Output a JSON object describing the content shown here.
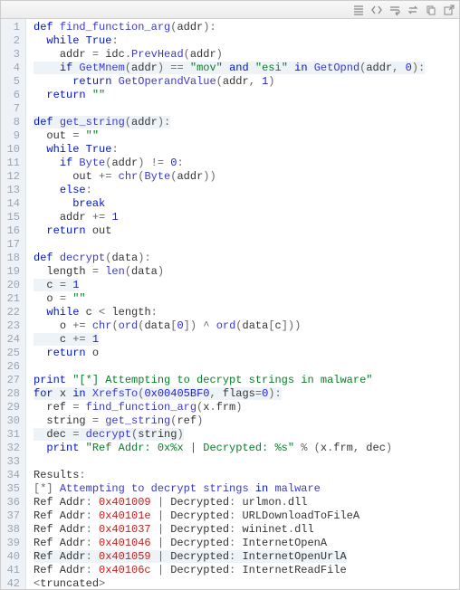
{
  "toolbar": {
    "icons": [
      "justify-icon",
      "code-icon",
      "wrap-icon",
      "swap-icon",
      "copy-icon",
      "popout-icon"
    ]
  },
  "highlights": [
    4,
    8,
    20,
    24,
    28,
    31,
    40
  ],
  "lines": [
    {
      "n": 1,
      "seg": [
        [
          "kw",
          "def "
        ],
        [
          "fn",
          "find_function_arg"
        ],
        [
          "op",
          "("
        ],
        [
          "ident",
          "addr"
        ],
        [
          "op",
          ")"
        ],
        [
          "op",
          ":"
        ]
      ]
    },
    {
      "n": 2,
      "seg": [
        [
          "",
          "  "
        ],
        [
          "kw",
          "while "
        ],
        [
          "kw",
          "True"
        ],
        [
          "op",
          ":"
        ]
      ]
    },
    {
      "n": 3,
      "seg": [
        [
          "",
          "    "
        ],
        [
          "ident",
          "addr "
        ],
        [
          "op",
          "= "
        ],
        [
          "ident",
          "idc"
        ],
        [
          "op",
          "."
        ],
        [
          "fn",
          "PrevHead"
        ],
        [
          "op",
          "("
        ],
        [
          "ident",
          "addr"
        ],
        [
          "op",
          ")"
        ]
      ]
    },
    {
      "n": 4,
      "seg": [
        [
          "",
          "    "
        ],
        [
          "kw",
          "if "
        ],
        [
          "fn",
          "GetMnem"
        ],
        [
          "op",
          "("
        ],
        [
          "ident",
          "addr"
        ],
        [
          "op",
          ") "
        ],
        [
          "op",
          "== "
        ],
        [
          "str",
          "\"mov\" "
        ],
        [
          "kw",
          "and "
        ],
        [
          "str",
          "\"esi\" "
        ],
        [
          "kw",
          "in "
        ],
        [
          "fn",
          "GetOpnd"
        ],
        [
          "op",
          "("
        ],
        [
          "ident",
          "addr"
        ],
        [
          "op",
          ", "
        ],
        [
          "num",
          "0"
        ],
        [
          "op",
          "):"
        ]
      ]
    },
    {
      "n": 5,
      "seg": [
        [
          "",
          "      "
        ],
        [
          "kw",
          "return "
        ],
        [
          "fn",
          "GetOperandValue"
        ],
        [
          "op",
          "("
        ],
        [
          "ident",
          "addr"
        ],
        [
          "op",
          ", "
        ],
        [
          "num",
          "1"
        ],
        [
          "op",
          ")"
        ]
      ]
    },
    {
      "n": 6,
      "seg": [
        [
          "",
          "  "
        ],
        [
          "kw",
          "return "
        ],
        [
          "str",
          "\"\""
        ]
      ]
    },
    {
      "n": 7,
      "seg": [
        [
          "",
          ""
        ]
      ]
    },
    {
      "n": 8,
      "seg": [
        [
          "kw",
          "def "
        ],
        [
          "fn",
          "get_string"
        ],
        [
          "op",
          "("
        ],
        [
          "ident",
          "addr"
        ],
        [
          "op",
          "):"
        ]
      ]
    },
    {
      "n": 9,
      "seg": [
        [
          "",
          "  "
        ],
        [
          "ident",
          "out "
        ],
        [
          "op",
          "= "
        ],
        [
          "str",
          "\"\""
        ]
      ]
    },
    {
      "n": 10,
      "seg": [
        [
          "",
          "  "
        ],
        [
          "kw",
          "while "
        ],
        [
          "kw",
          "True"
        ],
        [
          "op",
          ":"
        ]
      ]
    },
    {
      "n": 11,
      "seg": [
        [
          "",
          "    "
        ],
        [
          "kw",
          "if "
        ],
        [
          "fn",
          "Byte"
        ],
        [
          "op",
          "("
        ],
        [
          "ident",
          "addr"
        ],
        [
          "op",
          ") "
        ],
        [
          "op",
          "!= "
        ],
        [
          "num",
          "0"
        ],
        [
          "op",
          ":"
        ]
      ]
    },
    {
      "n": 12,
      "seg": [
        [
          "",
          "      "
        ],
        [
          "ident",
          "out "
        ],
        [
          "op",
          "+= "
        ],
        [
          "fn",
          "chr"
        ],
        [
          "op",
          "("
        ],
        [
          "fn",
          "Byte"
        ],
        [
          "op",
          "("
        ],
        [
          "ident",
          "addr"
        ],
        [
          "op",
          "))"
        ]
      ]
    },
    {
      "n": 13,
      "seg": [
        [
          "",
          "    "
        ],
        [
          "kw",
          "else"
        ],
        [
          "op",
          ":"
        ]
      ]
    },
    {
      "n": 14,
      "seg": [
        [
          "",
          "      "
        ],
        [
          "kw",
          "break"
        ]
      ]
    },
    {
      "n": 15,
      "seg": [
        [
          "",
          "    "
        ],
        [
          "ident",
          "addr "
        ],
        [
          "op",
          "+= "
        ],
        [
          "num",
          "1"
        ]
      ]
    },
    {
      "n": 16,
      "seg": [
        [
          "",
          "  "
        ],
        [
          "kw",
          "return "
        ],
        [
          "ident",
          "out"
        ]
      ]
    },
    {
      "n": 17,
      "seg": [
        [
          "",
          ""
        ]
      ]
    },
    {
      "n": 18,
      "seg": [
        [
          "kw",
          "def "
        ],
        [
          "fn",
          "decrypt"
        ],
        [
          "op",
          "("
        ],
        [
          "ident",
          "data"
        ],
        [
          "op",
          "):"
        ]
      ]
    },
    {
      "n": 19,
      "seg": [
        [
          "",
          "  "
        ],
        [
          "ident",
          "length "
        ],
        [
          "op",
          "= "
        ],
        [
          "fn",
          "len"
        ],
        [
          "op",
          "("
        ],
        [
          "ident",
          "data"
        ],
        [
          "op",
          ")"
        ]
      ]
    },
    {
      "n": 20,
      "seg": [
        [
          "",
          "  "
        ],
        [
          "ident",
          "c "
        ],
        [
          "op",
          "= "
        ],
        [
          "num",
          "1"
        ]
      ]
    },
    {
      "n": 21,
      "seg": [
        [
          "",
          "  "
        ],
        [
          "ident",
          "o "
        ],
        [
          "op",
          "= "
        ],
        [
          "str",
          "\"\""
        ]
      ]
    },
    {
      "n": 22,
      "seg": [
        [
          "",
          "  "
        ],
        [
          "kw",
          "while "
        ],
        [
          "ident",
          "c "
        ],
        [
          "op",
          "< "
        ],
        [
          "ident",
          "length"
        ],
        [
          "op",
          ":"
        ]
      ]
    },
    {
      "n": 23,
      "seg": [
        [
          "",
          "    "
        ],
        [
          "ident",
          "o "
        ],
        [
          "op",
          "+= "
        ],
        [
          "fn",
          "chr"
        ],
        [
          "op",
          "("
        ],
        [
          "fn",
          "ord"
        ],
        [
          "op",
          "("
        ],
        [
          "ident",
          "data"
        ],
        [
          "op",
          "["
        ],
        [
          "num",
          "0"
        ],
        [
          "op",
          "]) "
        ],
        [
          "op",
          "^ "
        ],
        [
          "fn",
          "ord"
        ],
        [
          "op",
          "("
        ],
        [
          "ident",
          "data"
        ],
        [
          "op",
          "["
        ],
        [
          "ident",
          "c"
        ],
        [
          "op",
          "]))"
        ]
      ]
    },
    {
      "n": 24,
      "seg": [
        [
          "",
          "    "
        ],
        [
          "ident",
          "c "
        ],
        [
          "op",
          "+= "
        ],
        [
          "num",
          "1"
        ]
      ]
    },
    {
      "n": 25,
      "seg": [
        [
          "",
          "  "
        ],
        [
          "kw",
          "return "
        ],
        [
          "ident",
          "o"
        ]
      ]
    },
    {
      "n": 26,
      "seg": [
        [
          "",
          ""
        ]
      ]
    },
    {
      "n": 27,
      "seg": [
        [
          "kw",
          "print "
        ],
        [
          "str",
          "\"[*] Attempting to decrypt strings in malware\""
        ]
      ]
    },
    {
      "n": 28,
      "seg": [
        [
          "kw",
          "for "
        ],
        [
          "ident",
          "x "
        ],
        [
          "kw",
          "in "
        ],
        [
          "fn",
          "XrefsTo"
        ],
        [
          "op",
          "("
        ],
        [
          "num",
          "0x00405BF0"
        ],
        [
          "op",
          ", "
        ],
        [
          "ident",
          "flags"
        ],
        [
          "op",
          "="
        ],
        [
          "num",
          "0"
        ],
        [
          "op",
          "):"
        ]
      ]
    },
    {
      "n": 29,
      "seg": [
        [
          "",
          "  "
        ],
        [
          "ident",
          "ref "
        ],
        [
          "op",
          "= "
        ],
        [
          "fn",
          "find_function_arg"
        ],
        [
          "op",
          "("
        ],
        [
          "ident",
          "x"
        ],
        [
          "op",
          "."
        ],
        [
          "ident",
          "frm"
        ],
        [
          "op",
          ")"
        ]
      ]
    },
    {
      "n": 30,
      "seg": [
        [
          "",
          "  "
        ],
        [
          "ident",
          "string "
        ],
        [
          "op",
          "= "
        ],
        [
          "fn",
          "get_string"
        ],
        [
          "op",
          "("
        ],
        [
          "ident",
          "ref"
        ],
        [
          "op",
          ")"
        ]
      ]
    },
    {
      "n": 31,
      "seg": [
        [
          "",
          "  "
        ],
        [
          "ident",
          "dec "
        ],
        [
          "op",
          "= "
        ],
        [
          "fn",
          "decrypt"
        ],
        [
          "op",
          "("
        ],
        [
          "ident",
          "string"
        ],
        [
          "op",
          ")"
        ]
      ]
    },
    {
      "n": 32,
      "seg": [
        [
          "",
          "  "
        ],
        [
          "kw",
          "print "
        ],
        [
          "str",
          "\"Ref Addr: 0x%x | Decrypted: %s\" "
        ],
        [
          "op",
          "% "
        ],
        [
          "op",
          "("
        ],
        [
          "ident",
          "x"
        ],
        [
          "op",
          "."
        ],
        [
          "ident",
          "frm"
        ],
        [
          "op",
          ", "
        ],
        [
          "ident",
          "dec"
        ],
        [
          "op",
          ")"
        ]
      ]
    },
    {
      "n": 33,
      "seg": [
        [
          "",
          ""
        ]
      ]
    },
    {
      "n": 34,
      "seg": [
        [
          "ident",
          "Results"
        ],
        [
          "op",
          ":"
        ]
      ]
    },
    {
      "n": 35,
      "seg": [
        [
          "op",
          "["
        ],
        [
          "op",
          "*"
        ],
        [
          "op",
          "] "
        ],
        [
          "fn",
          "Attempting to decrypt strings "
        ],
        [
          "kw",
          "in "
        ],
        [
          "fn",
          "malware"
        ]
      ]
    },
    {
      "n": 36,
      "seg": [
        [
          "ident",
          "Ref Addr"
        ],
        [
          "op",
          ": "
        ],
        [
          "hexaddr",
          "0x401009"
        ],
        [
          "op",
          " | "
        ],
        [
          "ident",
          "Decrypted"
        ],
        [
          "op",
          ": "
        ],
        [
          "ident",
          "urlmon"
        ],
        [
          "op",
          "."
        ],
        [
          "ident",
          "dll"
        ]
      ]
    },
    {
      "n": 37,
      "seg": [
        [
          "ident",
          "Ref Addr"
        ],
        [
          "op",
          ": "
        ],
        [
          "hexaddr",
          "0x40101e"
        ],
        [
          "op",
          " | "
        ],
        [
          "ident",
          "Decrypted"
        ],
        [
          "op",
          ": "
        ],
        [
          "ident",
          "URLDownloadToFileA"
        ]
      ]
    },
    {
      "n": 38,
      "seg": [
        [
          "ident",
          "Ref Addr"
        ],
        [
          "op",
          ": "
        ],
        [
          "hexaddr",
          "0x401037"
        ],
        [
          "op",
          " | "
        ],
        [
          "ident",
          "Decrypted"
        ],
        [
          "op",
          ": "
        ],
        [
          "ident",
          "wininet"
        ],
        [
          "op",
          "."
        ],
        [
          "ident",
          "dll"
        ]
      ]
    },
    {
      "n": 39,
      "seg": [
        [
          "ident",
          "Ref Addr"
        ],
        [
          "op",
          ": "
        ],
        [
          "hexaddr",
          "0x401046"
        ],
        [
          "op",
          " | "
        ],
        [
          "ident",
          "Decrypted"
        ],
        [
          "op",
          ": "
        ],
        [
          "ident",
          "InternetOpenA"
        ]
      ]
    },
    {
      "n": 40,
      "seg": [
        [
          "ident",
          "Ref Addr"
        ],
        [
          "op",
          ": "
        ],
        [
          "hexaddr",
          "0x401059"
        ],
        [
          "op",
          " | "
        ],
        [
          "ident",
          "Decrypted"
        ],
        [
          "op",
          ": "
        ],
        [
          "ident",
          "InternetOpenUrlA"
        ]
      ]
    },
    {
      "n": 41,
      "seg": [
        [
          "ident",
          "Ref Addr"
        ],
        [
          "op",
          ": "
        ],
        [
          "hexaddr",
          "0x40106c"
        ],
        [
          "op",
          " | "
        ],
        [
          "ident",
          "Decrypted"
        ],
        [
          "op",
          ": "
        ],
        [
          "ident",
          "InternetReadFile"
        ]
      ]
    },
    {
      "n": 42,
      "seg": [
        [
          "op",
          "<"
        ],
        [
          "ident",
          "truncated"
        ],
        [
          "op",
          ">"
        ]
      ]
    }
  ]
}
